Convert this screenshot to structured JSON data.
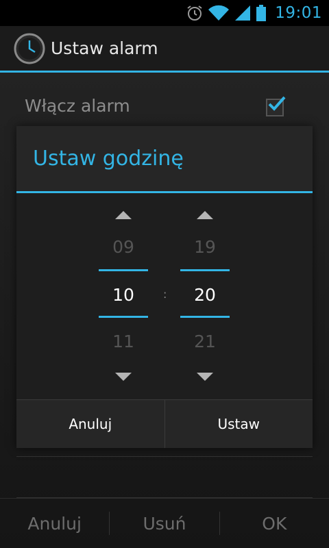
{
  "status_bar": {
    "time": "19:01",
    "icons": [
      "alarm-icon",
      "wifi-icon",
      "signal-icon",
      "battery-icon"
    ],
    "accent_color": "#33b5e5"
  },
  "action_bar": {
    "title": "Ustaw alarm",
    "icon": "clock-icon"
  },
  "settings": {
    "enable_alarm_label": "Włącz alarm",
    "enable_alarm_checked": true
  },
  "bottom_bar": {
    "cancel_label": "Anuluj",
    "delete_label": "Usuń",
    "ok_label": "OK"
  },
  "dialog": {
    "title": "Ustaw godzinę",
    "hours": {
      "prev": "09",
      "current": "10",
      "next": "11"
    },
    "separator": ":",
    "minutes": {
      "prev": "19",
      "current": "20",
      "next": "21"
    },
    "cancel_label": "Anuluj",
    "set_label": "Ustaw"
  }
}
